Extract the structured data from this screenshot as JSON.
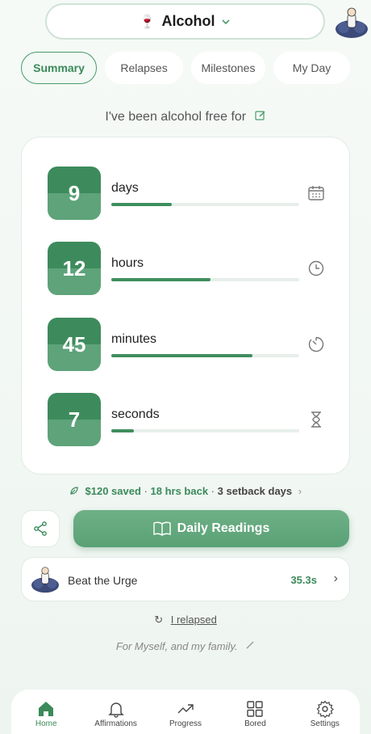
{
  "header": {
    "title": "Alcohol",
    "emoji": "🍷"
  },
  "tabs": [
    {
      "label": "Summary",
      "active": true
    },
    {
      "label": "Relapses"
    },
    {
      "label": "Milestones"
    },
    {
      "label": "My Day"
    }
  ],
  "free_for_label": "I've been alcohol free for",
  "counters": [
    {
      "value": "9",
      "unit": "days",
      "progress": 0.32,
      "icon": "calendar-icon"
    },
    {
      "value": "12",
      "unit": "hours",
      "progress": 0.53,
      "icon": "clock-icon"
    },
    {
      "value": "45",
      "unit": "minutes",
      "progress": 0.75,
      "icon": "timer-icon"
    },
    {
      "value": "7",
      "unit": "seconds",
      "progress": 0.12,
      "icon": "hourglass-icon"
    }
  ],
  "stats": {
    "saved": "$120 saved",
    "sep1": "·",
    "hrs_back": "18 hrs back",
    "sep2": "·",
    "setback": "3 setback days",
    "chevron": "›"
  },
  "daily_readings_label": "Daily Readings",
  "urge": {
    "label": "Beat the Urge",
    "time": "35.3s",
    "chevron": "›"
  },
  "relapsed": {
    "icon": "↻",
    "label": "I relapsed"
  },
  "motto": "For Myself, and my family.",
  "nav": [
    {
      "label": "Home",
      "icon": "home-icon",
      "active": true
    },
    {
      "label": "Affirmations",
      "icon": "bell-icon"
    },
    {
      "label": "Progress",
      "icon": "trend-icon"
    },
    {
      "label": "Bored",
      "icon": "grid-icon"
    },
    {
      "label": "Settings",
      "icon": "gear-icon"
    }
  ],
  "colors": {
    "accent": "#3f8e5f",
    "accent_light": "#5ea37a",
    "bg": "#f3f8f5"
  }
}
